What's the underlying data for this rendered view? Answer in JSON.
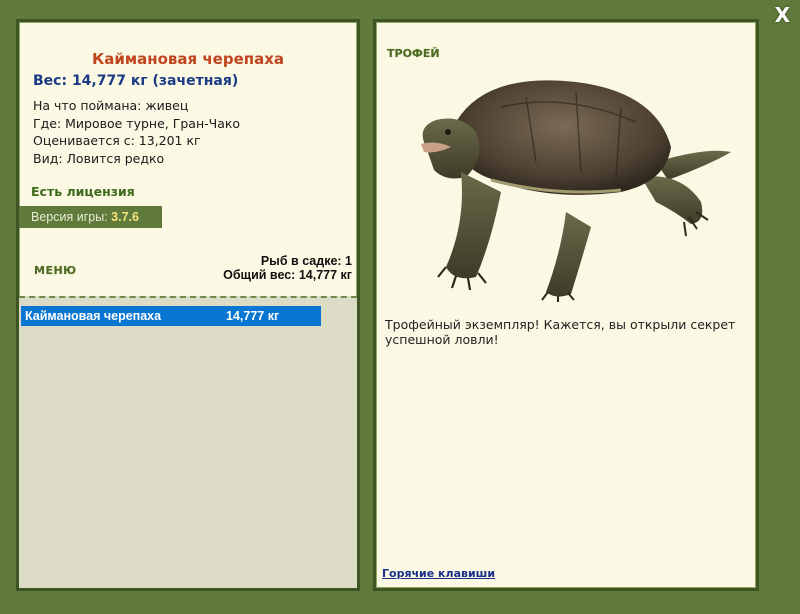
{
  "fish": {
    "title": "Каймановая черепаха",
    "weight_line": "Вес: 14,777 кг (зачетная)",
    "details": [
      "На что поймана: живец",
      "Где: Мировое турне, Гран-Чако",
      "Оценивается с: 13,201 кг",
      "Вид: Ловится редко"
    ]
  },
  "license": "Есть лицензия",
  "version": {
    "label": "Версия игры:",
    "value": "3.7.6"
  },
  "menu_label": "МЕНЮ",
  "stats": {
    "count_line": "Рыб в садке: 1",
    "total_line": "Общий вес: 14,777 кг"
  },
  "catch_list": [
    {
      "name": "Каймановая черепаха",
      "weight": "14,777 кг"
    }
  ],
  "trophy": {
    "label": "ТРОФЕЙ",
    "description": "Трофейный экземпляр! Кажется, вы открыли секрет успешной ловли!",
    "image_subject": "snapping-turtle"
  },
  "hotkeys_link": "Горячие клавиши",
  "close_label": "X",
  "colors": {
    "frame": "#5f7a3a",
    "panel": "#fbf9e3",
    "title": "#c0441d",
    "weight": "#1a3a86",
    "selected_row": "#0a76d3"
  }
}
